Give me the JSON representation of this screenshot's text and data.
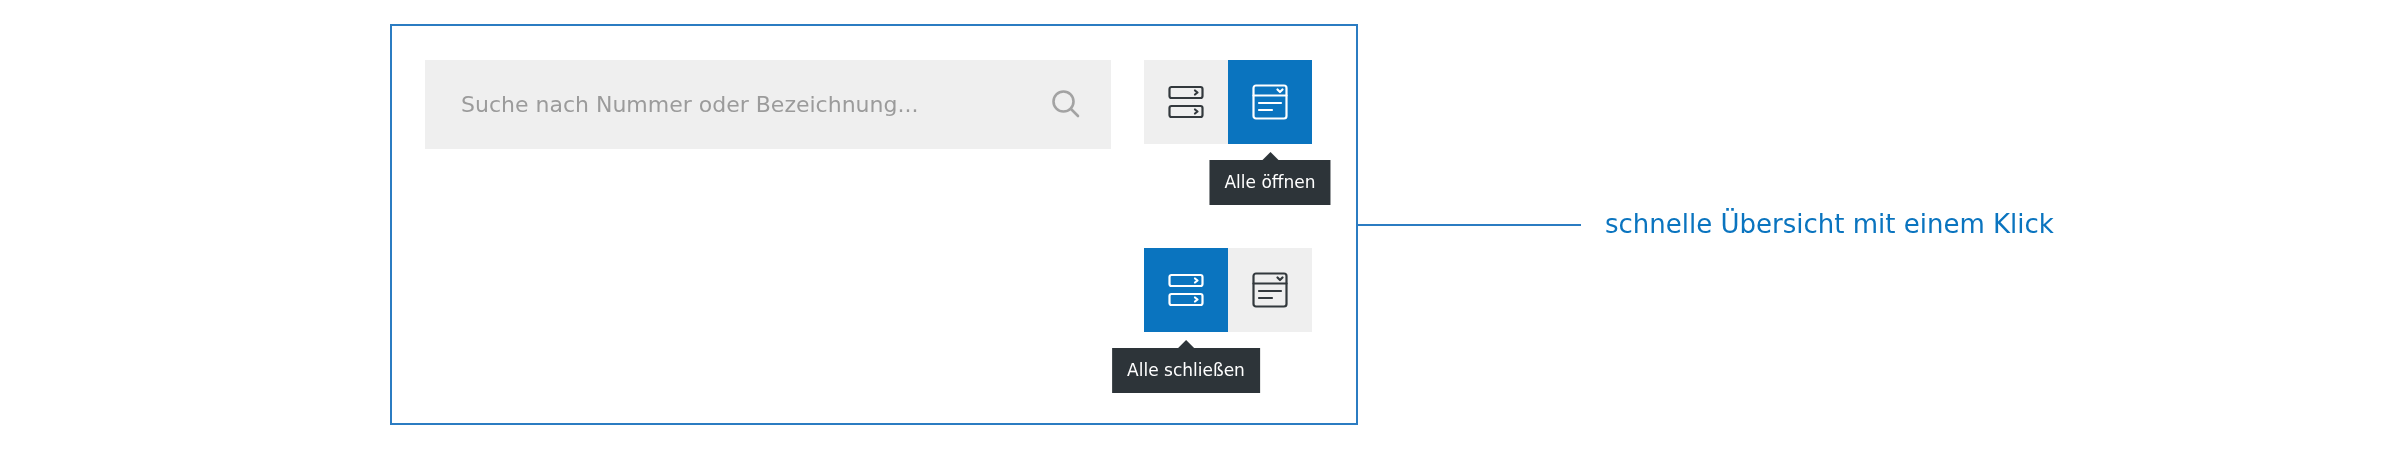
{
  "search": {
    "placeholder": "Suche nach Nummer oder Bezeichnung..."
  },
  "toggle_groups": [
    {
      "buttons": [
        {
          "kind": "collapse",
          "selected": false
        },
        {
          "kind": "expand",
          "selected": true
        }
      ],
      "tooltip": "Alle öffnen"
    },
    {
      "buttons": [
        {
          "kind": "collapse",
          "selected": true
        },
        {
          "kind": "expand",
          "selected": false
        }
      ],
      "tooltip": "Alle schließen"
    }
  ],
  "callout": "schnelle Übersicht mit einem Klick"
}
